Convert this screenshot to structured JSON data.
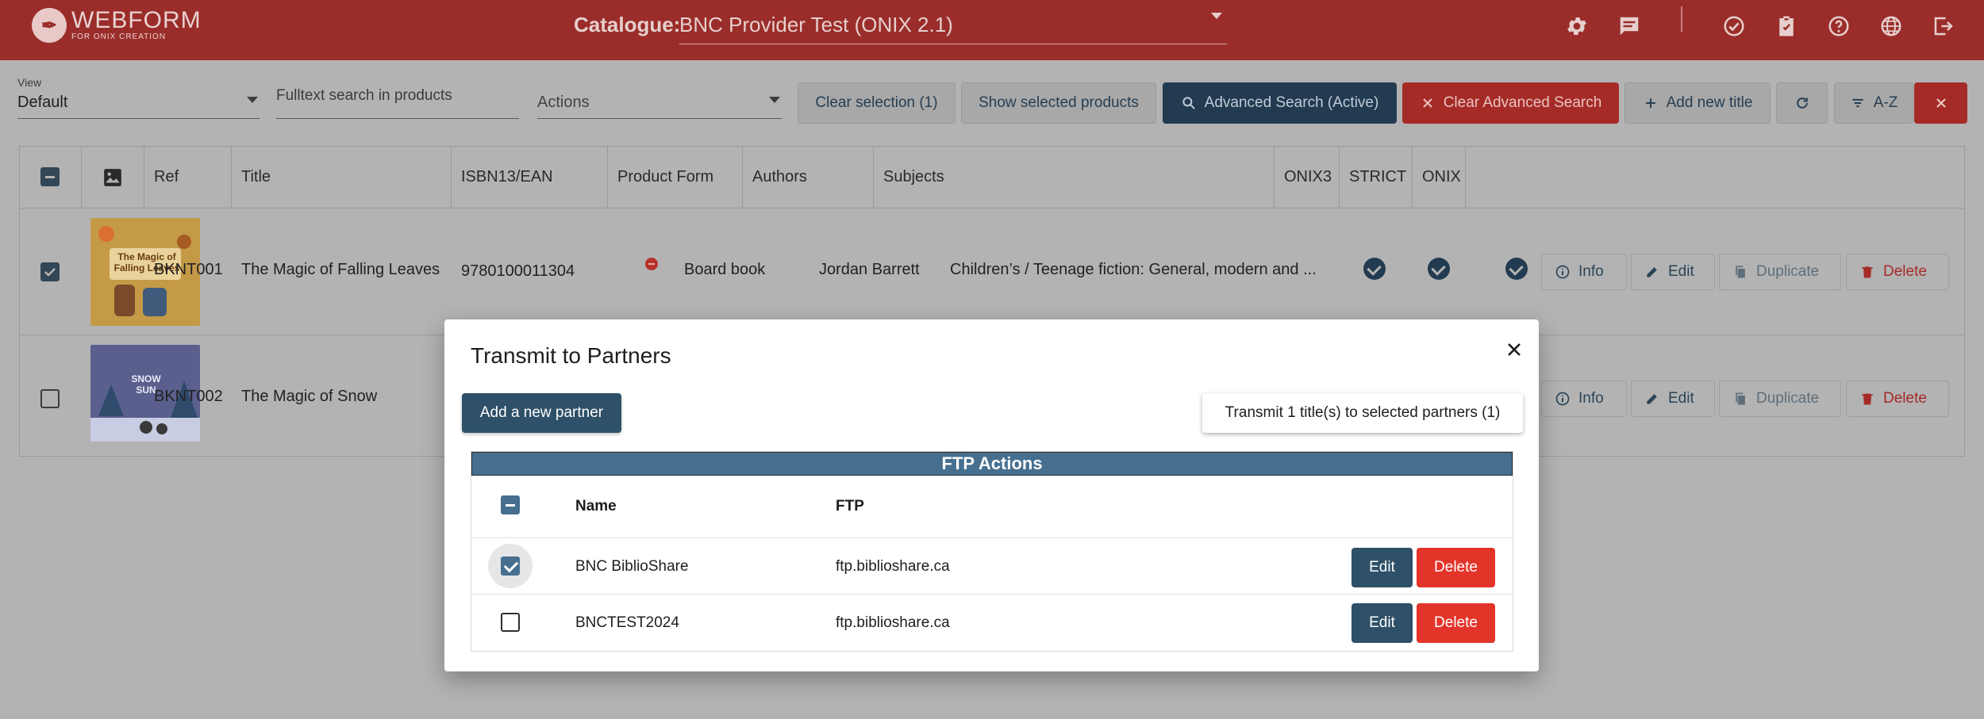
{
  "header": {
    "logo_title": "WEBFORM",
    "logo_subtitle": "FOR ONIX CREATION",
    "catalogue_label": "Catalogue:",
    "catalogue_value": "BNC Provider Test (ONIX 2.1)",
    "icons": [
      "gear-icon",
      "chat-icon",
      "check-circle-icon",
      "clipboard-check-icon",
      "help-icon",
      "globe-icon",
      "logout-icon"
    ]
  },
  "toolbar": {
    "view_label": "View",
    "view_value": "Default",
    "search_placeholder": "Fulltext search in products",
    "actions_placeholder": "Actions",
    "clear_selection": "Clear selection (1)",
    "show_selected": "Show selected products",
    "advanced_search": "Advanced Search (Active)",
    "clear_advanced": "Clear Advanced Search",
    "add_new_title": "Add new title",
    "sort_label": "A-Z"
  },
  "table": {
    "columns": [
      "Ref",
      "Title",
      "ISBN13/EAN",
      "Product Form",
      "Authors",
      "Subjects",
      "ONIX3",
      "STRICT",
      "ONIX"
    ],
    "rows": [
      {
        "ref": "BKNT001",
        "title": "The Magic of Falling Leaves",
        "isbn": "9780100011304",
        "form": "Board book",
        "authors": "Jordan Barrett",
        "subjects": "Children’s / Teenage fiction: General, modern and ...",
        "cover_title": "The Magic of Falling Leaves",
        "checked": true
      },
      {
        "ref": "BKNT002",
        "title": "The Magic of Snow",
        "cover_title": "SNOW SUN",
        "checked": false
      }
    ],
    "row_actions": {
      "info": "Info",
      "edit": "Edit",
      "duplicate": "Duplicate",
      "delete": "Delete"
    }
  },
  "modal": {
    "title": "Transmit to Partners",
    "add_partner": "Add a new partner",
    "transmit": "Transmit 1 title(s) to selected partners (1)",
    "ftp_header": "FTP Actions",
    "col_name": "Name",
    "col_ftp": "FTP",
    "partners": [
      {
        "name": "BNC BiblioShare",
        "ftp": "ftp.biblioshare.ca",
        "checked": true
      },
      {
        "name": "BNCTEST2024",
        "ftp": "ftp.biblioshare.ca",
        "checked": false
      }
    ],
    "edit": "Edit",
    "delete": "Delete"
  },
  "colors": {
    "header_bg": "#9a2d2a",
    "primary_dark": "#2e5068",
    "danger": "#e3342a",
    "ftp_header": "#466f8f"
  }
}
